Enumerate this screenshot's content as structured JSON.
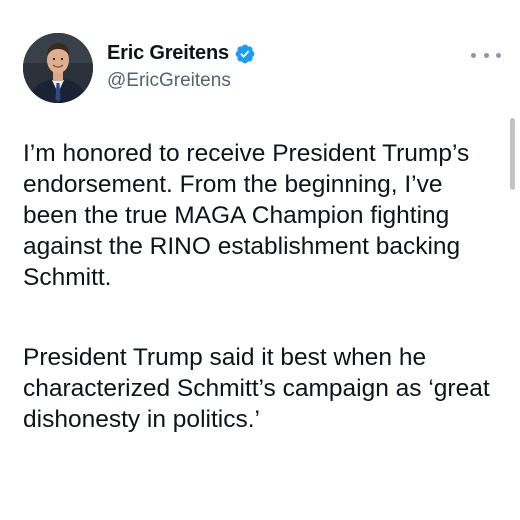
{
  "tweet": {
    "author": {
      "display_name": "Eric Greitens",
      "handle": "@EricGreitens",
      "verified": true,
      "verified_icon": "verified-badge-icon",
      "avatar": "profile-photo"
    },
    "more_icon": "more-options-icon",
    "paragraphs": [
      "I’m honored to receive President Trump’s endorsement. From the beginning, I’ve been the true MAGA Champion fighting against the RINO establishment backing Schmitt.",
      "President Trump said it best when he characterized Schmitt’s campaign as ‘great dishonesty in politics.’"
    ]
  },
  "colors": {
    "text": "#0f1419",
    "secondary_text": "#536471",
    "verified_blue": "#1d9bf0",
    "background": "#ffffff"
  }
}
